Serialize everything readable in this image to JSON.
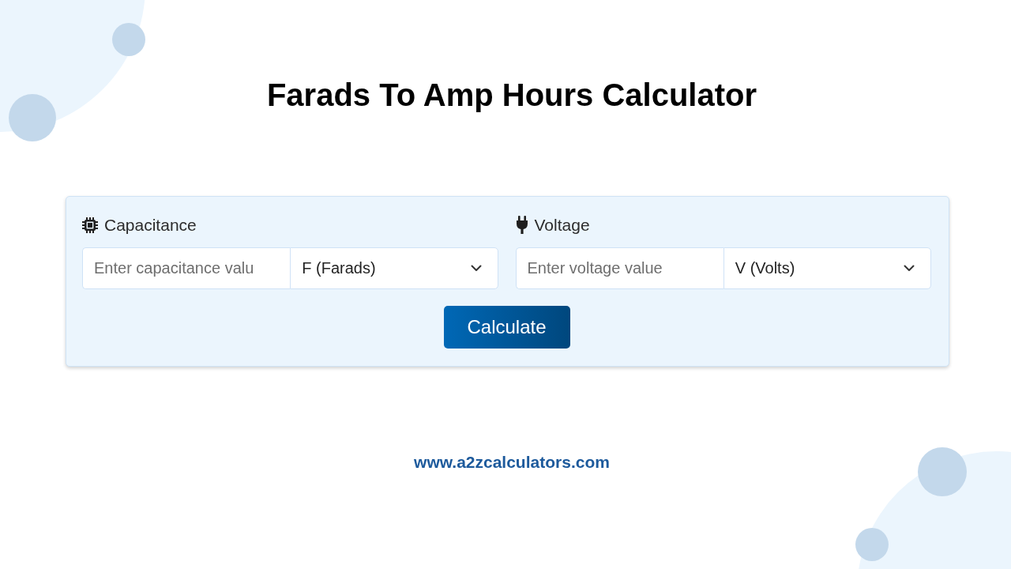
{
  "title": "Farads To Amp Hours Calculator",
  "calculator": {
    "fields": [
      {
        "label": "Capacitance",
        "placeholder": "Enter capacitance valu",
        "unit": "F (Farads)"
      },
      {
        "label": "Voltage",
        "placeholder": "Enter voltage value",
        "unit": "V (Volts)"
      }
    ],
    "button": "Calculate"
  },
  "footer": {
    "website": "www.a2zcalculators.com"
  }
}
